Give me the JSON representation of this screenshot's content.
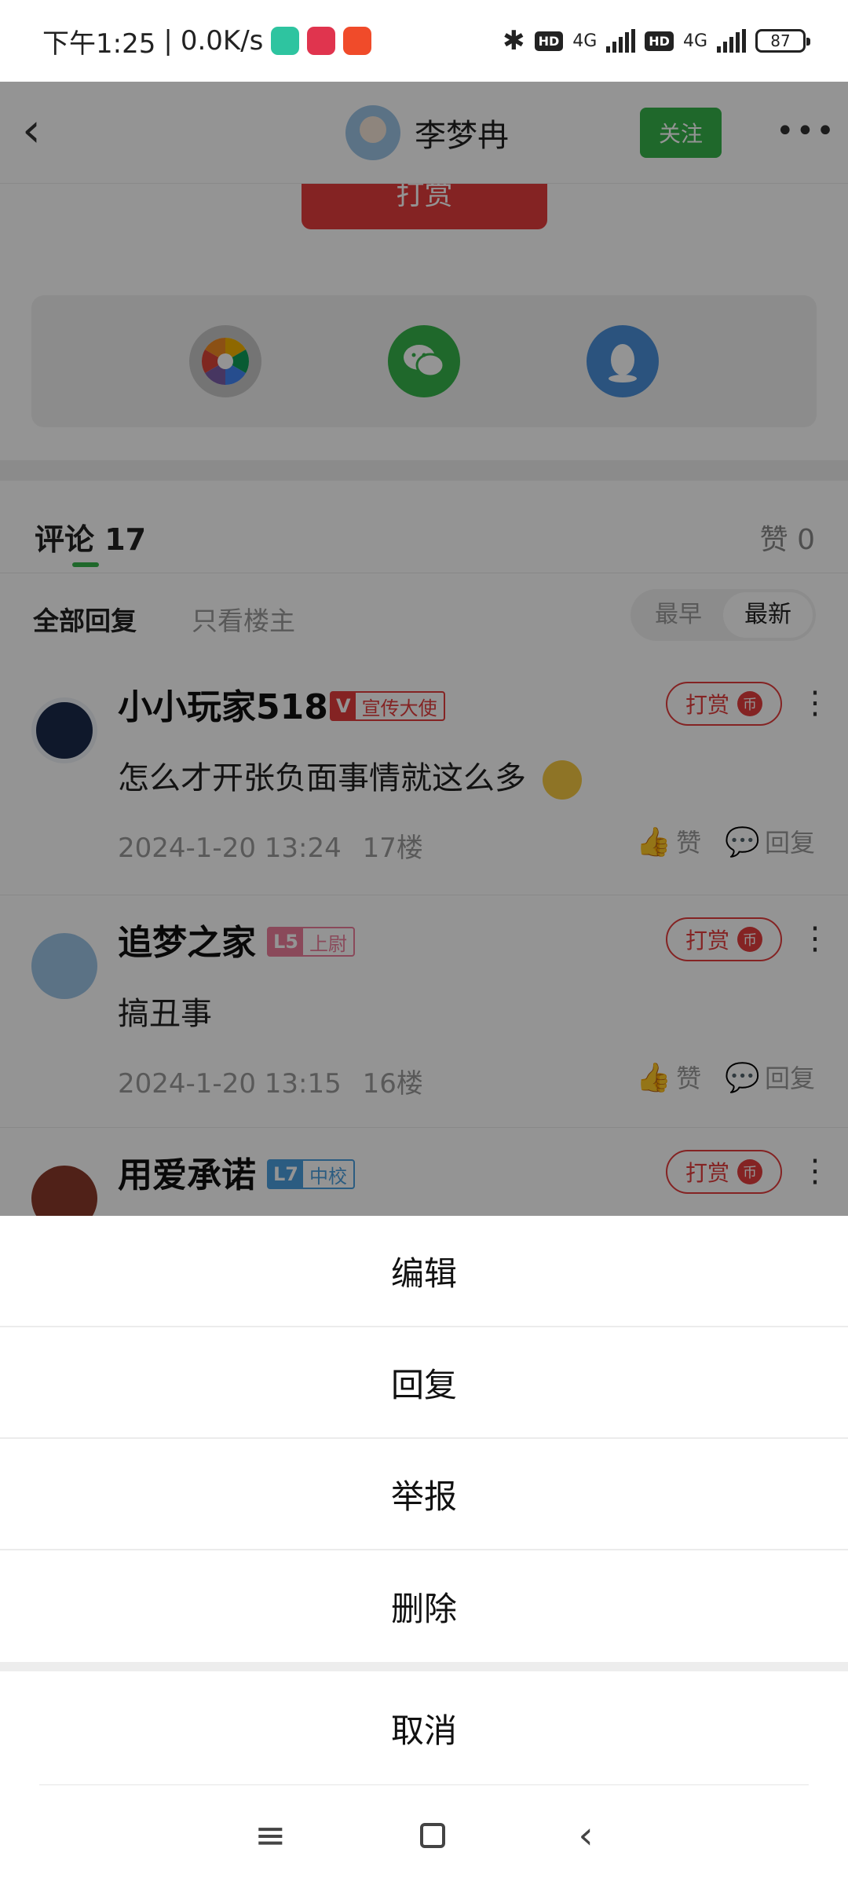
{
  "status_bar": {
    "time": "下午1:25",
    "speed": "0.0K/s",
    "network1": "4G",
    "network2": "4G",
    "hd": "HD",
    "battery": "87"
  },
  "header": {
    "username": "李梦冉",
    "follow_label": "关注",
    "more_glyph": "•••",
    "back_glyph": "‹"
  },
  "post": {
    "tip_button_label": "打赏"
  },
  "share_icons": [
    "camera-aperture-icon",
    "wechat-icon",
    "qq-icon"
  ],
  "comments_header": {
    "title": "评论 17",
    "likes": "赞 0"
  },
  "filters": {
    "all": "全部回复",
    "owner_only": "只看楼主",
    "sort_oldest": "最早",
    "sort_newest": "最新"
  },
  "comments": [
    {
      "name": "小小玩家518",
      "badge": "宣传大使",
      "badge_prefix": "V",
      "badge_color": "#e43d3d",
      "text": "怎么才开张负面事情就这么多",
      "date": "2024-1-20 13:24",
      "floor": "17楼",
      "tip_label": "打赏",
      "like_label": "赞",
      "reply_label": "回复"
    },
    {
      "name": "追梦之家",
      "badge": "上尉",
      "badge_prefix": "L5",
      "badge_color": "#ee7e9c",
      "text": "搞丑事",
      "date": "2024-1-20 13:15",
      "floor": "16楼",
      "tip_label": "打赏",
      "like_label": "赞",
      "reply_label": "回复"
    },
    {
      "name": "用爱承诺",
      "badge": "中校",
      "badge_prefix": "L7",
      "badge_color": "#4a9fdf",
      "tip_label": "打赏"
    }
  ],
  "tip_coin_glyph": "币",
  "action_sheet": {
    "items": [
      "编辑",
      "回复",
      "举报",
      "删除"
    ],
    "cancel": "取消"
  },
  "nav_bar": {
    "menu_glyph": "≡",
    "back_glyph": "‹"
  },
  "colors": {
    "accent_green": "#36b34a",
    "accent_red": "#e43d3d"
  }
}
